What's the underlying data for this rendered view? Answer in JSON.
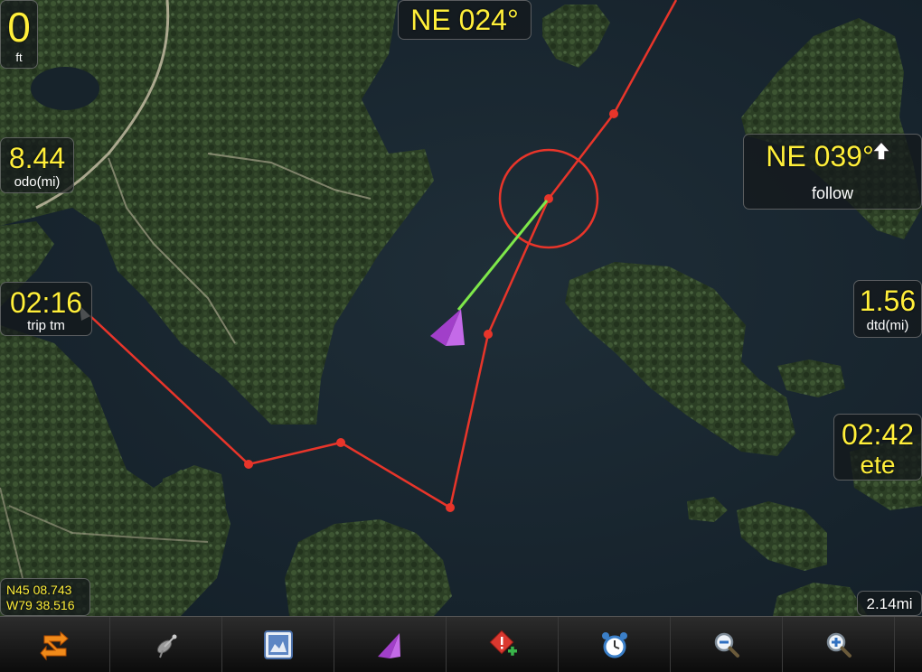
{
  "depth": {
    "value": "0",
    "unit": "ft"
  },
  "heading_top": {
    "value": "NE 024°"
  },
  "odometer": {
    "value": "8.44",
    "label": "odo(mi)"
  },
  "trip_time": {
    "value": "02:16",
    "label": "trip tm"
  },
  "bearing": {
    "value": "NE 039°",
    "label": "follow",
    "icon": "up-arrow-icon"
  },
  "dtd": {
    "value": "1.56",
    "label": "dtd(mi)"
  },
  "ete": {
    "value": "02:42",
    "label": "ete"
  },
  "position": {
    "lat": "N45 08.743",
    "lon": "W79 38.516"
  },
  "scale": {
    "value": "2.14mi"
  },
  "colors": {
    "route": "#e8352a",
    "track": "#7ee84a",
    "boat": "#b24fd6",
    "hud_value": "#ffef3a"
  },
  "toolbar": [
    {
      "name": "route-swap-icon"
    },
    {
      "name": "satellite-icon"
    },
    {
      "name": "map-chart-icon"
    },
    {
      "name": "boat-arrow-icon"
    },
    {
      "name": "add-waypoint-icon"
    },
    {
      "name": "alarm-clock-icon"
    },
    {
      "name": "zoom-out-icon"
    },
    {
      "name": "zoom-in-icon"
    }
  ]
}
